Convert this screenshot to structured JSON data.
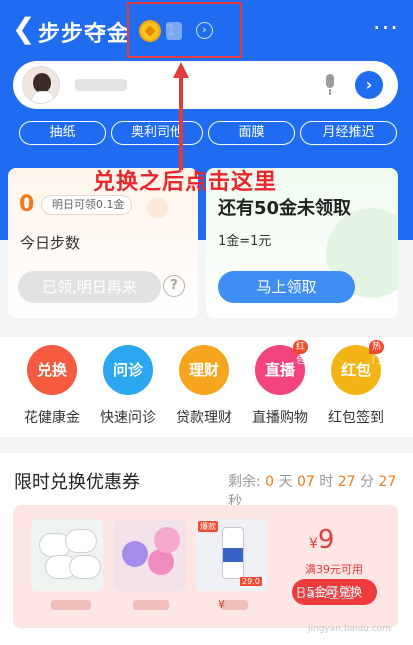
{
  "topbar": {
    "back_icon": "chevron-left-icon",
    "title": "步步夺金",
    "coin_count": "1",
    "coin_arrow": "›",
    "more_icon": "···"
  },
  "search": {
    "go_icon": "›"
  },
  "tags": [
    "抽纸",
    "奥利司他",
    "面膜",
    "月经推迟"
  ],
  "overlay_text": "兑换之后点击这里",
  "step_card": {
    "count": "0",
    "tip": "明日可领0.1金",
    "label": "今日步数",
    "button": "已领,明日再来",
    "help": "?"
  },
  "gold_card": {
    "title": "还有50金未领取",
    "rate": "1金=1元",
    "button": "马上领取"
  },
  "icons": [
    {
      "glyph": "兑换",
      "label": "花健康金",
      "badge": ""
    },
    {
      "glyph": "问诊",
      "label": "快速问诊",
      "badge": ""
    },
    {
      "glyph": "理财",
      "label": "贷款理财",
      "badge": ""
    },
    {
      "glyph": "直播",
      "label": "直播购物",
      "badge": "红包"
    },
    {
      "glyph": "红包",
      "label": "红包签到",
      "badge": "热门"
    }
  ],
  "coupon": {
    "title": "限时兑换优惠券",
    "countdown_prefix": "剩余:",
    "days": "0",
    "days_unit": "天",
    "hours": "07",
    "hours_unit": "时",
    "minutes": "27",
    "minutes_unit": "分",
    "seconds": "27",
    "seconds_unit": "秒",
    "price_symbol": "¥",
    "price": "9",
    "min_spend": "满39元可用",
    "exchange_button": "5金可兑换",
    "product3_tag": "爆款",
    "product3_price": "29.0",
    "product3_currency": "¥"
  },
  "watermark": "Bai 经验",
  "watermark_sub": "jingyan.baidu.com",
  "colors": {
    "brand_blue": "#1f6cf0",
    "accent_orange": "#f27a1a",
    "alert_red": "#e23b3b"
  }
}
